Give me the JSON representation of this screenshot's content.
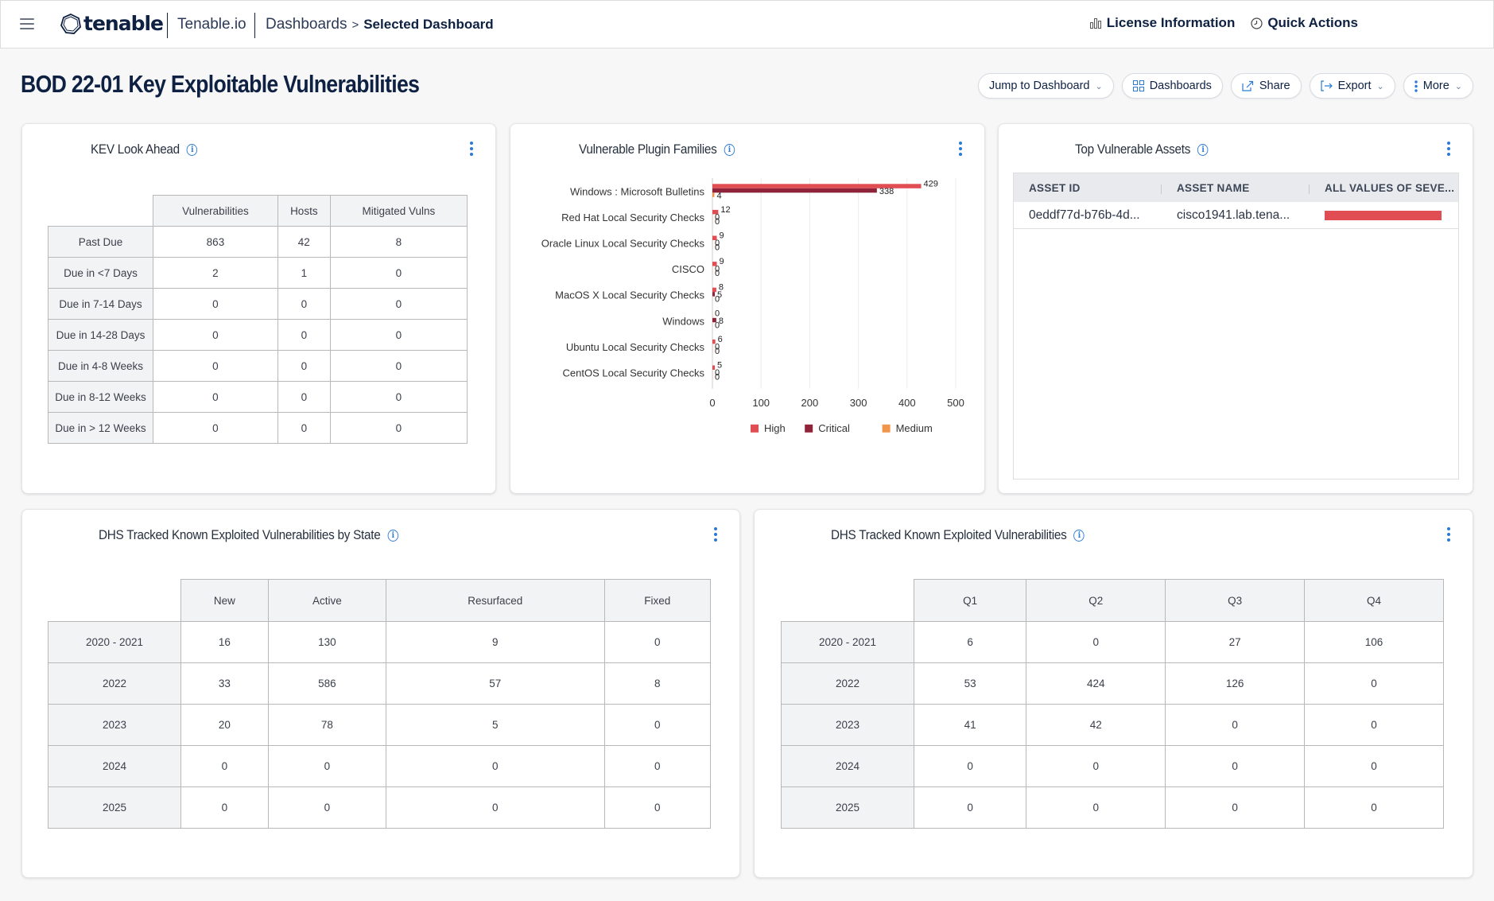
{
  "header": {
    "logo_text": "tenable",
    "product": "Tenable.io",
    "breadcrumb": {
      "parent": "Dashboards",
      "separator": ">",
      "current": "Selected Dashboard"
    },
    "actions": [
      {
        "label": "License Information",
        "icon": "bar-chart-icon"
      },
      {
        "label": "Quick Actions",
        "icon": "clock-icon"
      }
    ]
  },
  "page": {
    "title": "BOD 22-01 Key Exploitable Vulnerabilities",
    "toolbar": {
      "jump": "Jump to Dashboard",
      "dashboards": "Dashboards",
      "share": "Share",
      "export": "Export",
      "more": "More"
    }
  },
  "kev": {
    "title": "KEV Look Ahead",
    "columns": [
      "Vulnerabilities",
      "Hosts",
      "Mitigated Vulns"
    ],
    "rows": [
      {
        "label": "Past Due",
        "values": [
          "863",
          "42",
          "8"
        ]
      },
      {
        "label": "Due in <7 Days",
        "values": [
          "2",
          "1",
          "0"
        ]
      },
      {
        "label": "Due in 7-14 Days",
        "values": [
          "0",
          "0",
          "0"
        ]
      },
      {
        "label": "Due in 14-28 Days",
        "values": [
          "0",
          "0",
          "0"
        ]
      },
      {
        "label": "Due in 4-8 Weeks",
        "values": [
          "0",
          "0",
          "0"
        ]
      },
      {
        "label": "Due in 8-12 Weeks",
        "values": [
          "0",
          "0",
          "0"
        ]
      },
      {
        "label": "Due in > 12 Weeks",
        "values": [
          "0",
          "0",
          "0"
        ]
      }
    ]
  },
  "plugin_card": {
    "title": "Vulnerable Plugin Families"
  },
  "chart_data": {
    "type": "bar",
    "orientation": "horizontal",
    "title": "Vulnerable Plugin Families",
    "categories": [
      "Windows : Microsoft Bulletins",
      "Red Hat Local Security Checks",
      "Oracle Linux Local Security Checks",
      "CISCO",
      "MacOS X Local Security Checks",
      "Windows",
      "Ubuntu Local Security Checks",
      "CentOS Local Security Checks"
    ],
    "series": [
      {
        "name": "High",
        "color": "#e04d53",
        "values": [
          429,
          12,
          9,
          9,
          8,
          0,
          6,
          5
        ]
      },
      {
        "name": "Critical",
        "color": "#8e2339",
        "values": [
          338,
          0,
          0,
          0,
          5,
          8,
          0,
          0
        ]
      },
      {
        "name": "Medium",
        "color": "#f0954a",
        "values": [
          4,
          0,
          0,
          0,
          0,
          0,
          0,
          0
        ]
      }
    ],
    "xlim": [
      0,
      500
    ],
    "xticks": [
      "0",
      "100",
      "200",
      "300",
      "400",
      "500"
    ],
    "grid": true,
    "legend": "bottom"
  },
  "assets": {
    "title": "Top Vulnerable Assets",
    "columns": [
      "ASSET ID",
      "ASSET NAME",
      "ALL VALUES OF SEVE..."
    ],
    "rows": [
      {
        "id": "0eddf77d-b76b-4d...",
        "name": "cisco1941.lab.tena...",
        "severity_fill": 1.0
      }
    ]
  },
  "by_state": {
    "title": "DHS Tracked Known Exploited Vulnerabilities by State",
    "columns": [
      "New",
      "Active",
      "Resurfaced",
      "Fixed"
    ],
    "rows": [
      {
        "label": "2020 - 2021",
        "values": [
          "16",
          "130",
          "9",
          "0"
        ]
      },
      {
        "label": "2022",
        "values": [
          "33",
          "586",
          "57",
          "8"
        ]
      },
      {
        "label": "2023",
        "values": [
          "20",
          "78",
          "5",
          "0"
        ]
      },
      {
        "label": "2024",
        "values": [
          "0",
          "0",
          "0",
          "0"
        ]
      },
      {
        "label": "2025",
        "values": [
          "0",
          "0",
          "0",
          "0"
        ]
      }
    ]
  },
  "by_quarter": {
    "title": "DHS Tracked Known Exploited Vulnerabilities",
    "columns": [
      "Q1",
      "Q2",
      "Q3",
      "Q4"
    ],
    "rows": [
      {
        "label": "2020 - 2021",
        "values": [
          "6",
          "0",
          "27",
          "106"
        ]
      },
      {
        "label": "2022",
        "values": [
          "53",
          "424",
          "126",
          "0"
        ]
      },
      {
        "label": "2023",
        "values": [
          "41",
          "42",
          "0",
          "0"
        ]
      },
      {
        "label": "2024",
        "values": [
          "0",
          "0",
          "0",
          "0"
        ]
      },
      {
        "label": "2025",
        "values": [
          "0",
          "0",
          "0",
          "0"
        ]
      }
    ]
  },
  "colors": {
    "accent": "#2a7ad6",
    "navy": "#0e2142",
    "high": "#e04d53",
    "critical": "#8e2339",
    "medium": "#f0954a"
  }
}
